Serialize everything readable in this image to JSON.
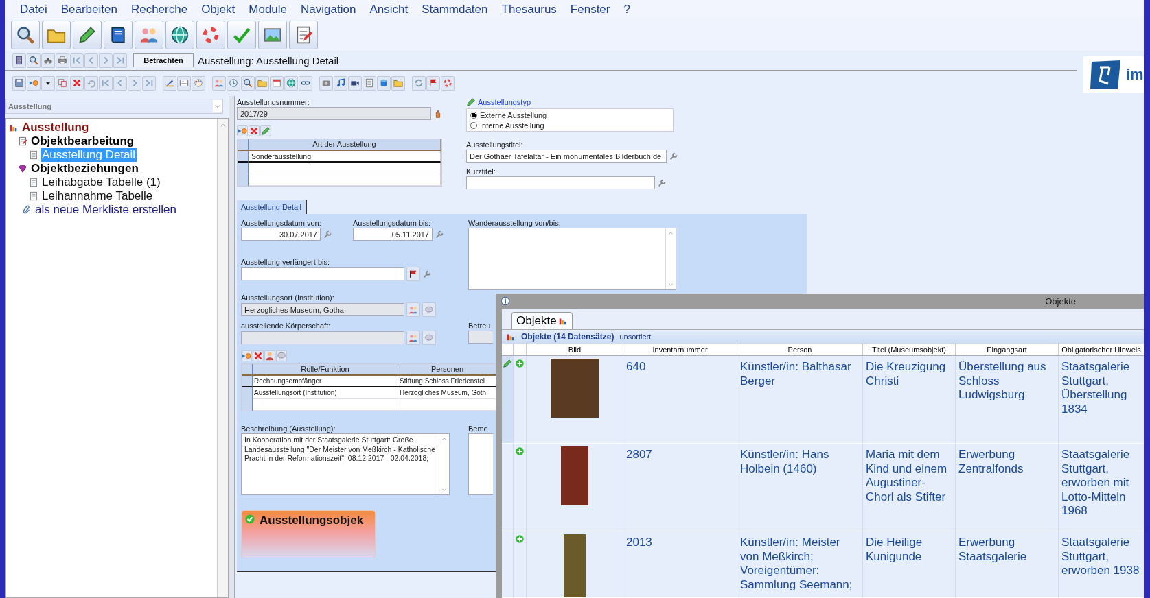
{
  "menu": [
    {
      "label": "Datei"
    },
    {
      "label": "Bearbeiten"
    },
    {
      "label": "Recherche"
    },
    {
      "label": "Objekt"
    },
    {
      "label": "Module"
    },
    {
      "label": "Navigation"
    },
    {
      "label": "Ansicht"
    },
    {
      "label": "Stammdaten"
    },
    {
      "label": "Thesaurus"
    },
    {
      "label": "Fenster"
    },
    {
      "label": "?"
    }
  ],
  "record_bar": {
    "mode_button": "Betrachten",
    "title": "Ausstellung: Ausstellung Detail"
  },
  "logo": {
    "text": "im"
  },
  "sidebar": {
    "selector": "Ausstellung",
    "tree": [
      {
        "label": "Ausstellung",
        "kind": "root",
        "selected": false,
        "children": [
          {
            "label": "Objektbearbeitung",
            "kind": "group",
            "selected": false,
            "children": [
              {
                "label": "Ausstellung Detail",
                "kind": "page",
                "selected": true
              }
            ]
          },
          {
            "label": "Objektbeziehungen",
            "kind": "group",
            "selected": false,
            "children": [
              {
                "label": "Leihabgabe Tabelle (1)",
                "kind": "page",
                "selected": false
              },
              {
                "label": "Leihannahme Tabelle",
                "kind": "page",
                "selected": false
              }
            ]
          },
          {
            "label": "als neue Merkliste erstellen",
            "kind": "action",
            "selected": false
          }
        ]
      }
    ]
  },
  "form": {
    "number": {
      "label": "Ausstellungsnummer:",
      "value": "2017/29"
    },
    "art_table": {
      "column": "Art der Ausstellung",
      "rows": [
        {
          "value": "Sonderausstellung",
          "selected": true
        }
      ]
    },
    "type": {
      "label": "Ausstellungstyp",
      "options": [
        {
          "label": "Externe Ausstellung",
          "selected": true
        },
        {
          "label": "Interne Ausstellung",
          "selected": false
        }
      ]
    },
    "title_field": {
      "label": "Ausstellungstitel:",
      "value": "Der Gothaer Tafelaltar - Ein monumentales Bilderbuch de"
    },
    "short_title": {
      "label": "Kurztitel:"
    },
    "tabs": [
      {
        "label": "Ausstellung Detail",
        "selected": true
      }
    ],
    "date_from": {
      "label": "Ausstellungsdatum von:",
      "value": "30.07.2017"
    },
    "date_to": {
      "label": "Ausstellungsdatum bis:",
      "value": "05.11.2017"
    },
    "touring": {
      "label": "Wanderausstellung von/bis:"
    },
    "extended": {
      "label": "Ausstellung verlängert bis:"
    },
    "venue": {
      "label": "Ausstellungsort (Institution):",
      "value": "Herzogliches Museum, Gotha"
    },
    "organizer": {
      "label": "ausstellende Körperschaft:"
    },
    "supervisor": {
      "label": "Betreu"
    },
    "roles_table": {
      "columns": [
        "Rolle/Funktion",
        "Personen"
      ],
      "rows": [
        {
          "cells": [
            "Rechnungsempfänger",
            "Stiftung Schloss Friedenstei"
          ],
          "selected": true
        },
        {
          "cells": [
            "Ausstellungsort (Institution)",
            "Herzogliches Museum, Goth"
          ],
          "selected": false
        }
      ]
    },
    "description": {
      "label": "Beschreibung (Ausstellung):",
      "value": "In Kooperation mit der Staatsgalerie Stuttgart: Große Landesausstellung \"Der Meister von Meßkirch - Katholische Pracht in der Reformationszeit\", 08.12.2017 - 02.04.2018;"
    },
    "remarks": {
      "label": "Beme"
    },
    "objects_button": "Ausstellungsobjek"
  },
  "objects_window": {
    "title": "Objekte",
    "tab": "Objekte",
    "header": "Objekte (14 Datensätze)",
    "sort": "unsortiert",
    "columns": [
      "Bild",
      "Inventarnummer",
      "Person",
      "Titel (Museumsobjekt)",
      "Eingangsart",
      "Obligatorischer Hinweis"
    ],
    "rows": [
      {
        "selected": true,
        "cells": [
          "",
          "640",
          "Künstler/in: Balthasar Berger",
          "Die Kreuzigung Christi",
          "Überstellung aus Schloss Ludwigsburg",
          "Staatsgalerie Stuttgart, Überstellung 1834"
        ]
      },
      {
        "selected": false,
        "cells": [
          "",
          "2807",
          "Künstler/in: Hans Holbein (1460)",
          "Maria mit dem Kind und einem Augustiner-Chorl als Stifter",
          "Erwerbung Zentralfonds",
          "Staatsgalerie Stuttgart, erworben mit Lotto-Mitteln 1968"
        ]
      },
      {
        "selected": false,
        "cells": [
          "",
          "2013",
          "Künstler/in: Meister von Meßkirch; Voreigentümer: Sammlung Seemann;",
          "Die Heilige Kunigunde",
          "Erwerbung Staatsgalerie",
          "Staatsgalerie Stuttgart, erworben 1938"
        ]
      }
    ]
  }
}
